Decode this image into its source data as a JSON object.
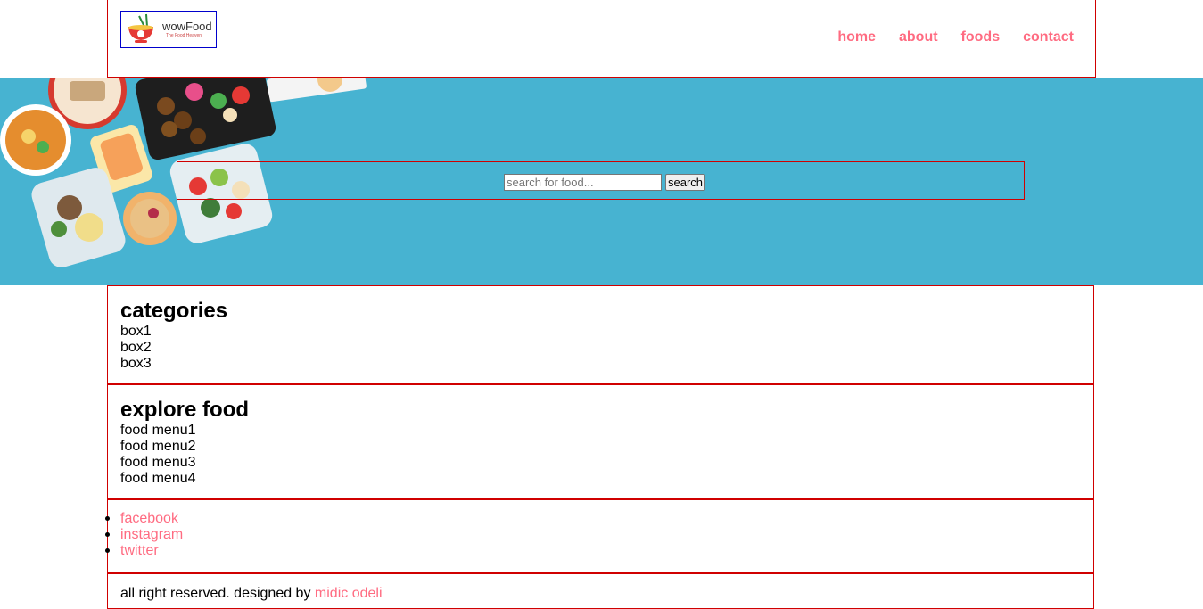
{
  "brand": {
    "name": "wowFood",
    "tagline": "The Food Heaven"
  },
  "nav": {
    "items": [
      {
        "label": "home"
      },
      {
        "label": "about"
      },
      {
        "label": "foods"
      },
      {
        "label": "contact"
      }
    ]
  },
  "search": {
    "placeholder": "search for food...",
    "value": "",
    "button_label": "search"
  },
  "categories": {
    "heading": "categories",
    "items": [
      "box1",
      "box2",
      "box3"
    ]
  },
  "explore": {
    "heading": "explore food",
    "items": [
      "food menu1",
      "food menu2",
      "food menu3",
      "food menu4"
    ]
  },
  "social": {
    "links": [
      "facebook",
      "instagram",
      "twitter"
    ]
  },
  "footer": {
    "text": "all right reserved. designed by",
    "author": "midic odeli"
  },
  "colors": {
    "accent": "#ff6b81",
    "hero_bg": "#47b3d1",
    "border": "#d00000"
  }
}
